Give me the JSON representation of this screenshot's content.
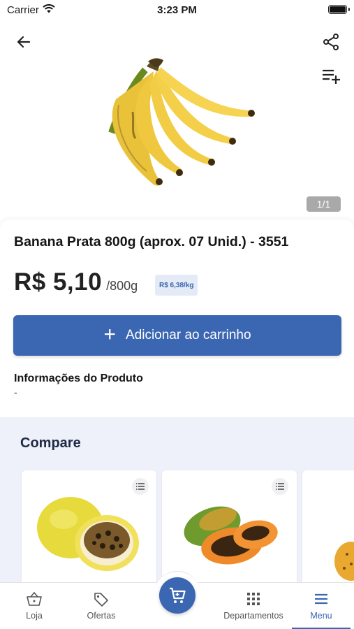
{
  "status_bar": {
    "carrier": "Carrier",
    "time": "3:23 PM"
  },
  "product": {
    "image_icon": "banana-bunch-image",
    "image_counter": "1/1",
    "title": "Banana Prata 800g (aprox. 07 Unid.) - 3551",
    "price": "R$ 5,10",
    "unit": "/800g",
    "price_per_kg": "R$ 6,38/kg",
    "add_to_cart_label": "Adicionar ao carrinho",
    "info_heading": "Informações do Produto",
    "info_body": "-"
  },
  "compare": {
    "title": "Compare",
    "items": [
      {
        "image": "passion-fruit-image"
      },
      {
        "image": "papaya-image"
      },
      {
        "image": "pineapple-image"
      }
    ]
  },
  "bottom_nav": {
    "items": [
      {
        "label": "Loja",
        "icon": "basket-icon"
      },
      {
        "label": "Ofertas",
        "icon": "tag-icon"
      },
      {
        "label": "Departamentos",
        "icon": "grid-icon"
      },
      {
        "label": "Menu",
        "icon": "menu-icon"
      }
    ],
    "active": "Menu",
    "cart_icon": "cart-icon"
  },
  "colors": {
    "accent": "#3b66b1",
    "accent_light": "#e4ebf7",
    "compare_bg": "#eef0fa",
    "counter_bg": "#a9a9a9"
  }
}
